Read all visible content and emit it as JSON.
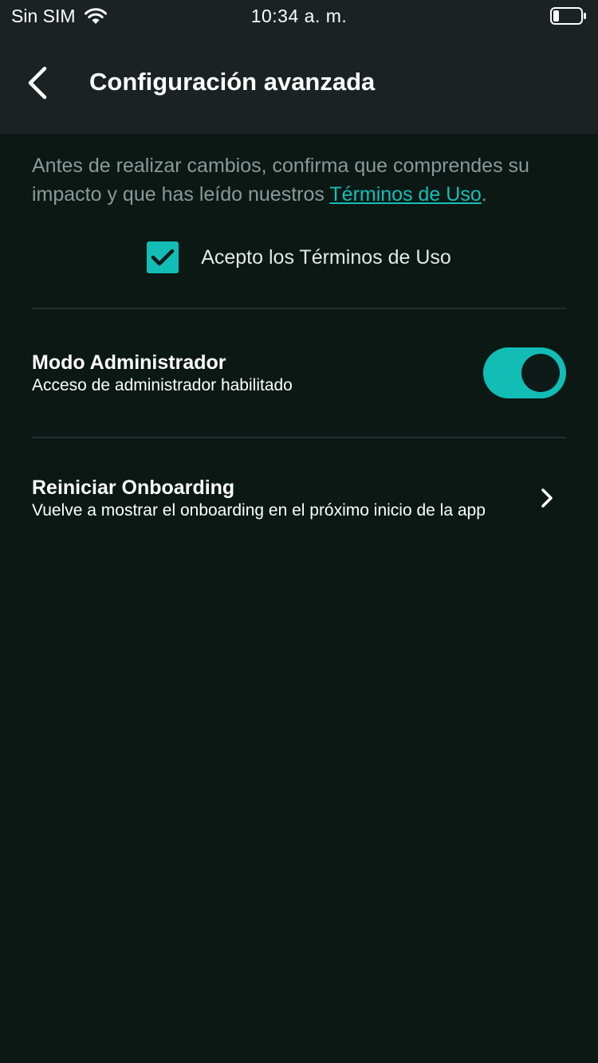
{
  "status_bar": {
    "carrier": "Sin SIM",
    "time": "10:34 a. m.",
    "icons": [
      "wifi-icon",
      "battery-icon"
    ]
  },
  "header": {
    "back_icon": "chevron-left-icon",
    "title": "Configuración avanzada"
  },
  "intro": {
    "text": "Antes de realizar cambios, confirma que comprendes su impacto y que has leído nuestros ",
    "link": "Términos de Uso",
    "end": "."
  },
  "terms": {
    "checked": true,
    "label": "Acepto los Términos de Uso"
  },
  "admin_mode": {
    "title": "Modo Administrador",
    "subtitle": "Acceso de administrador habilitado",
    "enabled": true
  },
  "reset_onboarding": {
    "title": "Reiniciar Onboarding",
    "subtitle": "Vuelve a mostrar el onboarding en el próximo inicio de la app",
    "icon": "chevron-right-icon"
  },
  "colors": {
    "accent": "#12bdb6",
    "background": "#0b1814",
    "header": "#1b2224"
  }
}
